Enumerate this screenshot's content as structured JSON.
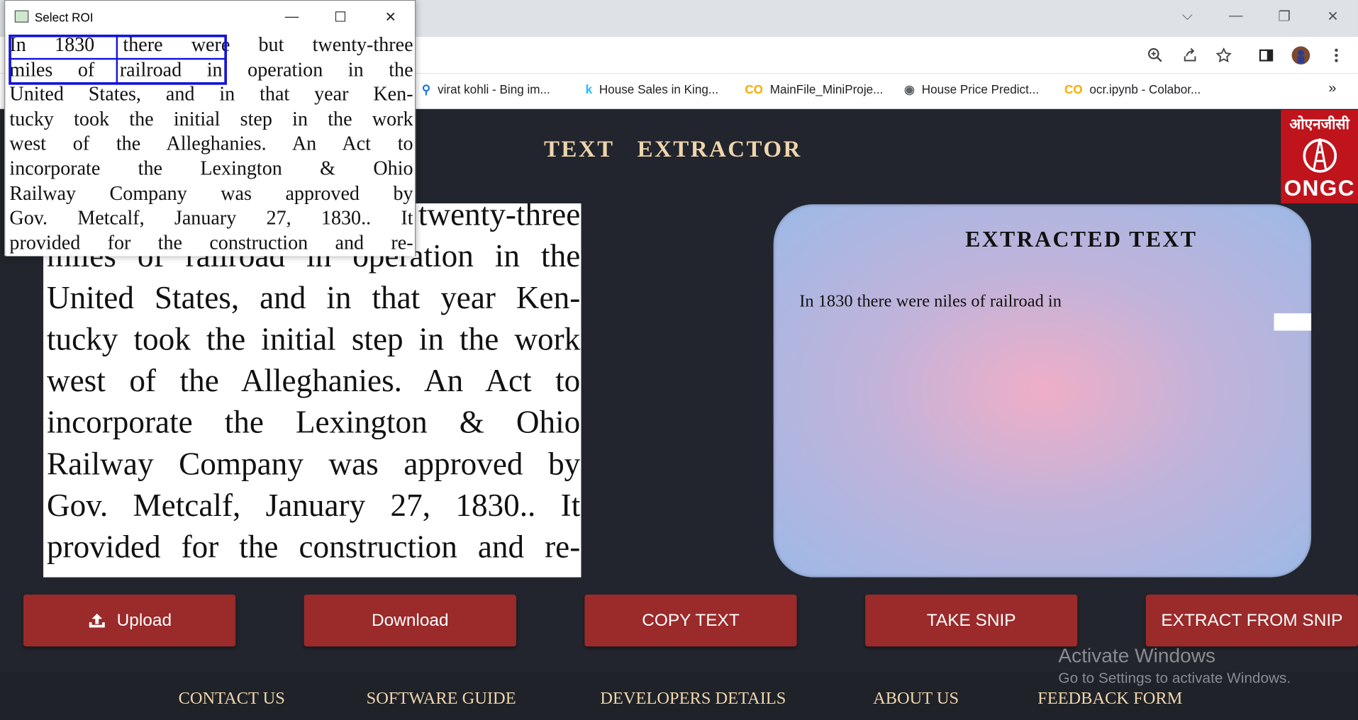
{
  "browser": {
    "window_controls": {
      "dropdown": "⌵",
      "minimize": "—",
      "restore": "❐",
      "close": "✕"
    },
    "bookmarks": [
      {
        "icon": "search-icon",
        "label": "virat kohli - Bing im..."
      },
      {
        "icon": "kaggle-icon",
        "label": "House Sales in King..."
      },
      {
        "icon": "colab-icon",
        "label": "MainFile_MiniProje..."
      },
      {
        "icon": "globe-icon",
        "label": "House Price Predict..."
      },
      {
        "icon": "colab-icon",
        "label": "ocr.ipynb - Colabor..."
      }
    ],
    "more_bookmarks": "»"
  },
  "app": {
    "title": "TEXT EXTRACTOR",
    "logo_top": "ओएनजीसी",
    "logo_bottom": "ONGC",
    "scanned_lines": [
      "In 1830 there were but twenty-three",
      "miles of railroad in operation in the",
      "United States, and in that year Ken-",
      "tucky took the initial step in the work",
      "west of the Alleghanies. An Act to",
      "incorporate the Lexington & Ohio",
      "Railway Company was approved by",
      "Gov. Metcalf, January 27, 1830.. It",
      "provided for the construction and re-"
    ],
    "extracted_title": "EXTRACTED TEXT",
    "extracted_text": "In 1830 there were niles of railroad in",
    "buttons": {
      "upload": "Upload",
      "download": "Download",
      "copy": "COPY TEXT",
      "snip": "TAKE SNIP",
      "extract": "EXTRACT FROM SNIP"
    },
    "footer": [
      "CONTACT US",
      "SOFTWARE GUIDE",
      "DEVELOPERS DETAILS",
      "ABOUT US",
      "FEEDBACK FORM"
    ]
  },
  "roi_window": {
    "title": "Select ROI",
    "controls": {
      "minimize": "—",
      "maximize": "☐",
      "close": "✕"
    }
  },
  "watermark": {
    "line1": "Activate Windows",
    "line2": "Go to Settings to activate Windows."
  },
  "colors": {
    "accent": "#9b2a2a",
    "background": "#22252d",
    "gold": "#efd5ad",
    "selection": "#1414d8"
  }
}
